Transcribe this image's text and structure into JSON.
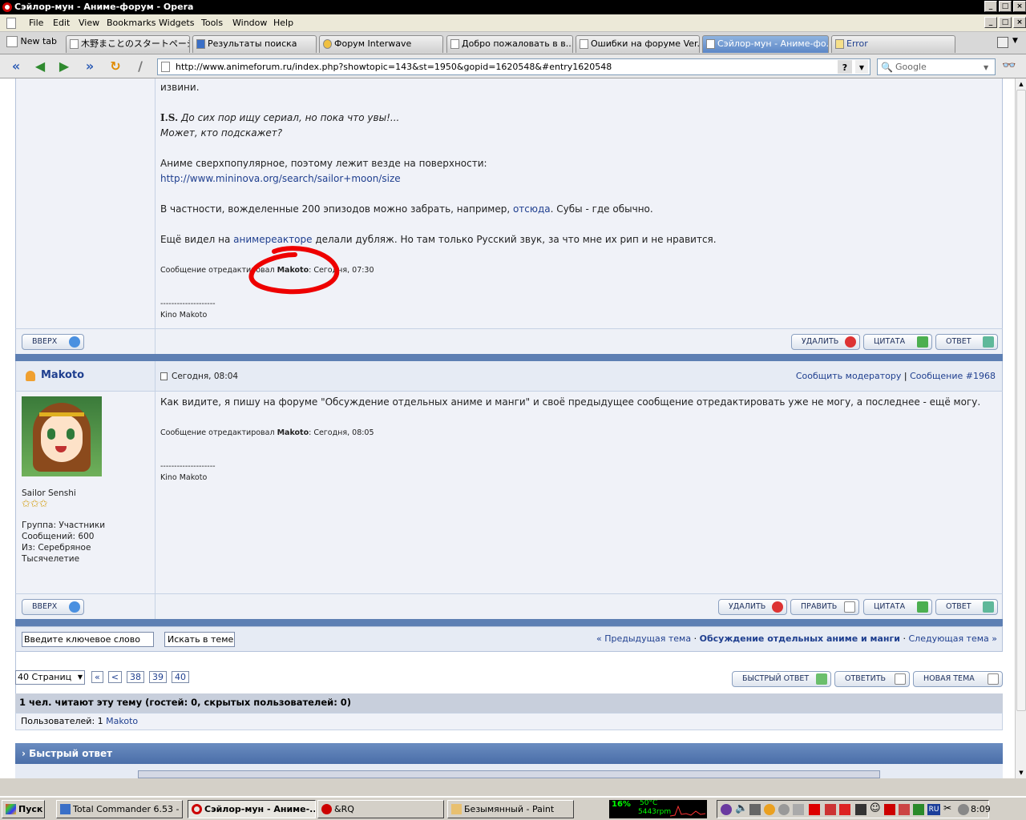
{
  "window": {
    "title": "Сэйлор-мун - Аниме-форум - Opera"
  },
  "menu": [
    "File",
    "Edit",
    "View",
    "Bookmarks",
    "Widgets",
    "Tools",
    "Window",
    "Help"
  ],
  "tabs": {
    "new_tab": "New tab",
    "items": [
      "木野まことのスタートページ",
      "Результаты поиска",
      "Форум Interwave",
      "Добро пожаловать в в...",
      "Ошибки на форуме Ver...",
      "Сэйлор-мун - Аниме-фо...",
      "Error"
    ]
  },
  "address": {
    "url": "http://www.animeforum.ru/index.php?showtopic=143&st=1950&gopid=1620548&#entry1620548",
    "search_placeholder": "Google"
  },
  "post1": {
    "line0": "извини.",
    "is_label": "I.S.",
    "is_text": "До сих пор ищу сериал, но пока что увы!...",
    "is_text2": "Может, кто подскажет?",
    "p1": "Аниме сверхпопулярное, поэтому лежит везде на поверхности:",
    "link1": "http://www.mininova.org/search/sailor+moon/size",
    "p2a": "В частности, вожделенные 200 эпизодов можно забрать, например, ",
    "p2link": "отсюда",
    "p2b": ". Субы - где обычно.",
    "p3a": "Ещё видел на ",
    "p3link": "анимереакторе",
    "p3b": " делали дубляж. Но там только Русский звук, за что мне их рип и не нравится.",
    "edited_prefix": "Сообщение отредактировал ",
    "edited_user": "Makoto",
    "edited_suffix": ": Сегодня, 07:30",
    "sig_line": "--------------------",
    "sig": "Kino Makoto",
    "btn_up": "ВВЕРХ",
    "btn_delete": "УДАЛИТЬ",
    "btn_quote": "ЦИТАТА",
    "btn_reply": "ОТВЕТ"
  },
  "post2": {
    "author": "Makoto",
    "date": "Сегодня, 08:04",
    "report": "Сообщить модератору",
    "sep": "|",
    "msgnum": "Сообщение #1968",
    "text": "Как видите, я пишу на форуме \"Обсуждение отдельных аниме и манги\" и своё предыдущее сообщение отредактировать уже не могу, а последнее - ещё могу.",
    "edited_prefix": "Сообщение отредактировал ",
    "edited_user": "Makoto",
    "edited_suffix": ": Сегодня, 08:05",
    "sig_line": "--------------------",
    "sig": "Kino Makoto",
    "rank": "Sailor Senshi",
    "stars": "✩✩✩",
    "group": "Группа: Участники",
    "posts": "Сообщений: 600",
    "from": "Из: Серебряное",
    "from2": "Тысячелетие",
    "btn_up": "ВВЕРХ",
    "btn_delete": "УДАЛИТЬ",
    "btn_edit": "ПРАВИТЬ",
    "btn_quote": "ЦИТАТА",
    "btn_reply": "ОТВЕТ"
  },
  "bottom": {
    "search_placeholder": "Введите ключевое слово",
    "search_btn": "Искать в теме",
    "prev": "« Предыдущая тема",
    "dot1": "·",
    "forum": "Обсуждение отдельных аниме и манги",
    "dot2": "·",
    "next": "Следующая тема »",
    "pages_select": "40 Страниц",
    "pages": [
      "«",
      "<",
      "38",
      "39",
      "40"
    ],
    "quick_reply": "БЫСТРЫЙ ОТВЕТ",
    "reply": "ОТВЕТИТЬ",
    "new_topic": "НОВАЯ ТЕМА",
    "readers": "1 чел. читают эту тему (гостей: 0, скрытых пользователей: 0)",
    "users_prefix": "Пользователей: 1 ",
    "users_name": "Makoto",
    "quick_header": "Быстрый ответ"
  },
  "taskbar": {
    "start": "Пуск",
    "items": [
      "Total Commander 6.53 - ...",
      "Сэйлор-мун - Аниме-...",
      "&RQ",
      "Безымянный - Paint"
    ],
    "cpu": "16%",
    "temp": "50°C",
    "rpm": "5443rpm",
    "lang": "RU",
    "clock": "8:09"
  }
}
